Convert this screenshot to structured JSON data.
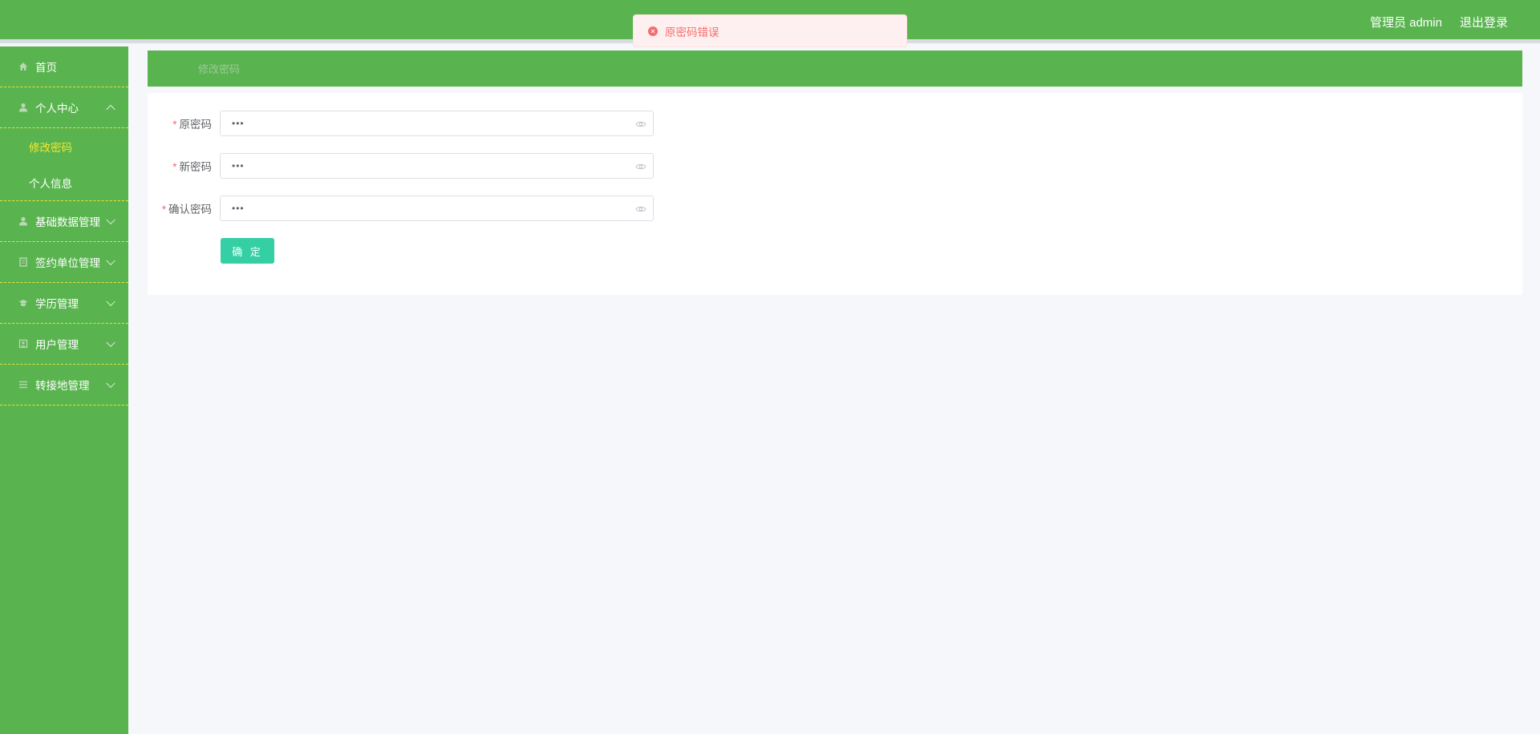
{
  "header": {
    "user_label": "管理员 admin",
    "logout_label": "退出登录"
  },
  "toast": {
    "message": "原密码错误",
    "type": "error"
  },
  "sidebar": {
    "items": [
      {
        "label": "首页",
        "icon": "home-icon"
      },
      {
        "label": "个人中心",
        "icon": "user-icon",
        "expanded": true,
        "children": [
          {
            "label": "修改密码",
            "active": true
          },
          {
            "label": "个人信息",
            "active": false
          }
        ]
      },
      {
        "label": "基础数据管理",
        "icon": "user-icon"
      },
      {
        "label": "签约单位管理",
        "icon": "building-icon"
      },
      {
        "label": "学历管理",
        "icon": "graduation-icon"
      },
      {
        "label": "用户管理",
        "icon": "users-icon"
      },
      {
        "label": "转接地管理",
        "icon": "list-icon"
      }
    ]
  },
  "breadcrumb": {
    "current": "修改密码"
  },
  "form": {
    "old_password": {
      "label": "原密码",
      "value": "•••"
    },
    "new_password": {
      "label": "新密码",
      "value": "•••"
    },
    "confirm_password": {
      "label": "确认密码",
      "value": "•••"
    },
    "submit_label": "确 定"
  },
  "colors": {
    "brand_green": "#59b44f",
    "active_yellow": "#f5e531",
    "button_teal": "#35cfa5",
    "error_red": "#f56c6c"
  }
}
